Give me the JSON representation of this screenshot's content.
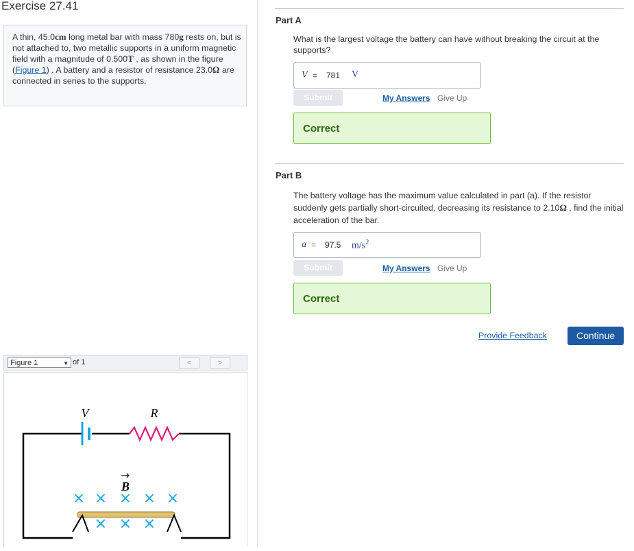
{
  "exercise_title": "Exercise 27.41",
  "problem": {
    "text_1": "A thin, 45.0",
    "unit_cm": "cm",
    "text_2": " long metal bar with mass 780",
    "unit_g": "g",
    "text_3": " rests on, but is not attached to, two metallic supports in a uniform magnetic field with a magnitude of 0.500",
    "unit_T": "T",
    "text_4": " , as shown in the figure (",
    "figure_link": "Figure 1",
    "text_5": ") . A battery and a resistor of resistance 23.0",
    "unit_ohm": "Ω",
    "text_6": " are connected in series to the supports."
  },
  "figure": {
    "select_label": "Figure 1",
    "of_label": "of 1",
    "prev_glyph": "<",
    "next_glyph": ">",
    "label_V": "V",
    "label_R": "R",
    "label_B": "B",
    "cross_glyph": "×",
    "colors": {
      "wire": "#000000",
      "battery": "#1aa6e0",
      "resistor": "#e01a7c",
      "bar": "#e2c26f",
      "cross": "#1aa6e0"
    }
  },
  "partA": {
    "label": "Part A",
    "question": "What is the largest voltage the battery can have without breaking the circuit at the supports?",
    "answer_var": "V",
    "equals": "=",
    "answer_value": "781",
    "answer_unit": "V",
    "submit_label": "Submit",
    "my_answers_label": "My Answers",
    "give_up_label": "Give Up",
    "result": "Correct"
  },
  "partB": {
    "label": "Part B",
    "question_1": "The battery voltage has the maximum value calculated in part (a). If the resistor suddenly gets partially short-circuited, decreasing its resistance to 2.10",
    "unit_ohm": "Ω",
    "question_2": " , find the initial acceleration of the bar.",
    "answer_var": "a",
    "equals": "=",
    "answer_value": "97.5",
    "answer_unit_base": "m/s",
    "answer_unit_exp": "2",
    "submit_label": "Submit",
    "my_answers_label": "My Answers",
    "give_up_label": "Give Up",
    "result": "Correct"
  },
  "footer": {
    "feedback_label": "Provide Feedback",
    "continue_label": "Continue"
  }
}
